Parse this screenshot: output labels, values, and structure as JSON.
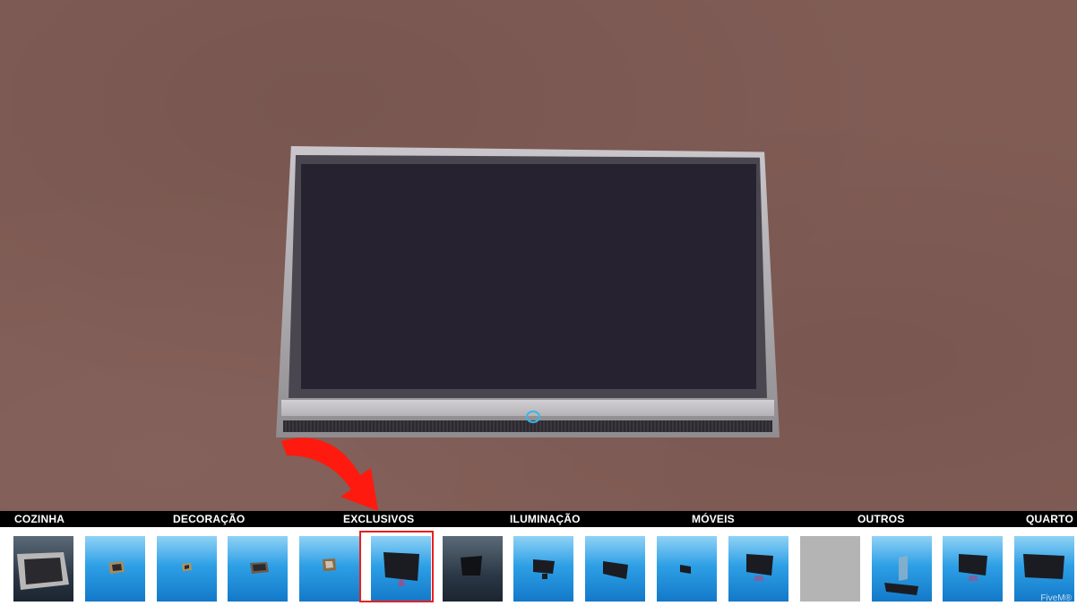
{
  "categories": [
    {
      "label": "COZINHA"
    },
    {
      "label": "DECORAÇÃO"
    },
    {
      "label": "EXCLUSIVOS"
    },
    {
      "label": "ILUMINAÇÃO"
    },
    {
      "label": "MÓVEIS"
    },
    {
      "label": "OUTROS"
    },
    {
      "label": "QUARTO"
    }
  ],
  "items": [
    {
      "name": "item-tv-crt-large"
    },
    {
      "name": "item-tv-box-small"
    },
    {
      "name": "item-tv-box-tiny"
    },
    {
      "name": "item-tv-box-wide"
    },
    {
      "name": "item-tv-retro"
    },
    {
      "name": "item-tv-flat-selected",
      "selected": true
    },
    {
      "name": "item-tv-flat-dark"
    },
    {
      "name": "item-tv-flat-stand"
    },
    {
      "name": "item-tv-flat-angled"
    },
    {
      "name": "item-tv-flat-small"
    },
    {
      "name": "item-tv-flat-stand-2"
    },
    {
      "name": "item-empty"
    },
    {
      "name": "item-tv-wall-mount"
    },
    {
      "name": "item-tv-flat-stand-3"
    },
    {
      "name": "item-tv-flat-large"
    }
  ],
  "watermark": "FiveM®",
  "colors": {
    "floor": "#805c55",
    "selection": "#e8201f",
    "arrow": "#ff1a0f",
    "tile_blue": "#2ea0e6",
    "power_light": "#35b8e8"
  }
}
